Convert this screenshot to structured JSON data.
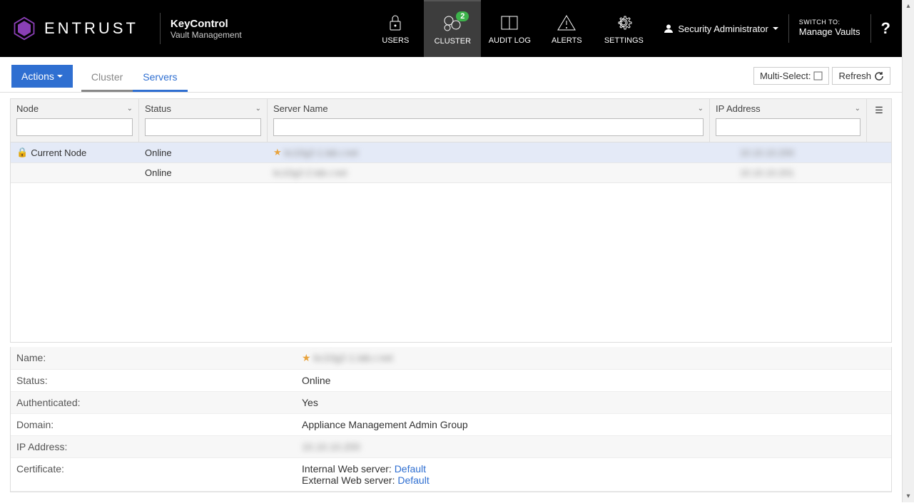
{
  "brand": "ENTRUST",
  "product": {
    "title": "KeyControl",
    "sub": "Vault Management"
  },
  "topnav": {
    "users": "USERS",
    "cluster": "CLUSTER",
    "cluster_badge": "2",
    "auditlog": "AUDIT LOG",
    "alerts": "ALERTS",
    "settings": "SETTINGS"
  },
  "user": "Security Administrator",
  "switch": {
    "label": "SWITCH TO:",
    "target": "Manage Vaults"
  },
  "help": "?",
  "actions": "Actions",
  "tabs": {
    "cluster": "Cluster",
    "servers": "Servers"
  },
  "tools": {
    "multiselect": "Multi-Select:",
    "refresh": "Refresh"
  },
  "grid": {
    "headers": {
      "node": "Node",
      "status": "Status",
      "server": "Server Name",
      "ip": "IP Address"
    },
    "rows": [
      {
        "node": "Current Node",
        "status": "Online",
        "server": "kc10g2-1.lab.r.net",
        "ip": "10.10.10.200"
      },
      {
        "node": "",
        "status": "Online",
        "server": "kc10g2-2.lab.r.net",
        "ip": "10.10.10.201"
      }
    ]
  },
  "details": {
    "name_label": "Name:",
    "name_value": "kc10g2-1.lab.r.net",
    "status_label": "Status:",
    "status_value": "Online",
    "auth_label": "Authenticated:",
    "auth_value": "Yes",
    "domain_label": "Domain:",
    "domain_value": "Appliance Management Admin Group",
    "ip_label": "IP Address:",
    "ip_value": "10.10.10.200",
    "cert_label": "Certificate:",
    "cert_internal_prefix": "Internal Web server: ",
    "cert_internal_link": "Default",
    "cert_external_prefix": "External Web server: ",
    "cert_external_link": "Default"
  }
}
